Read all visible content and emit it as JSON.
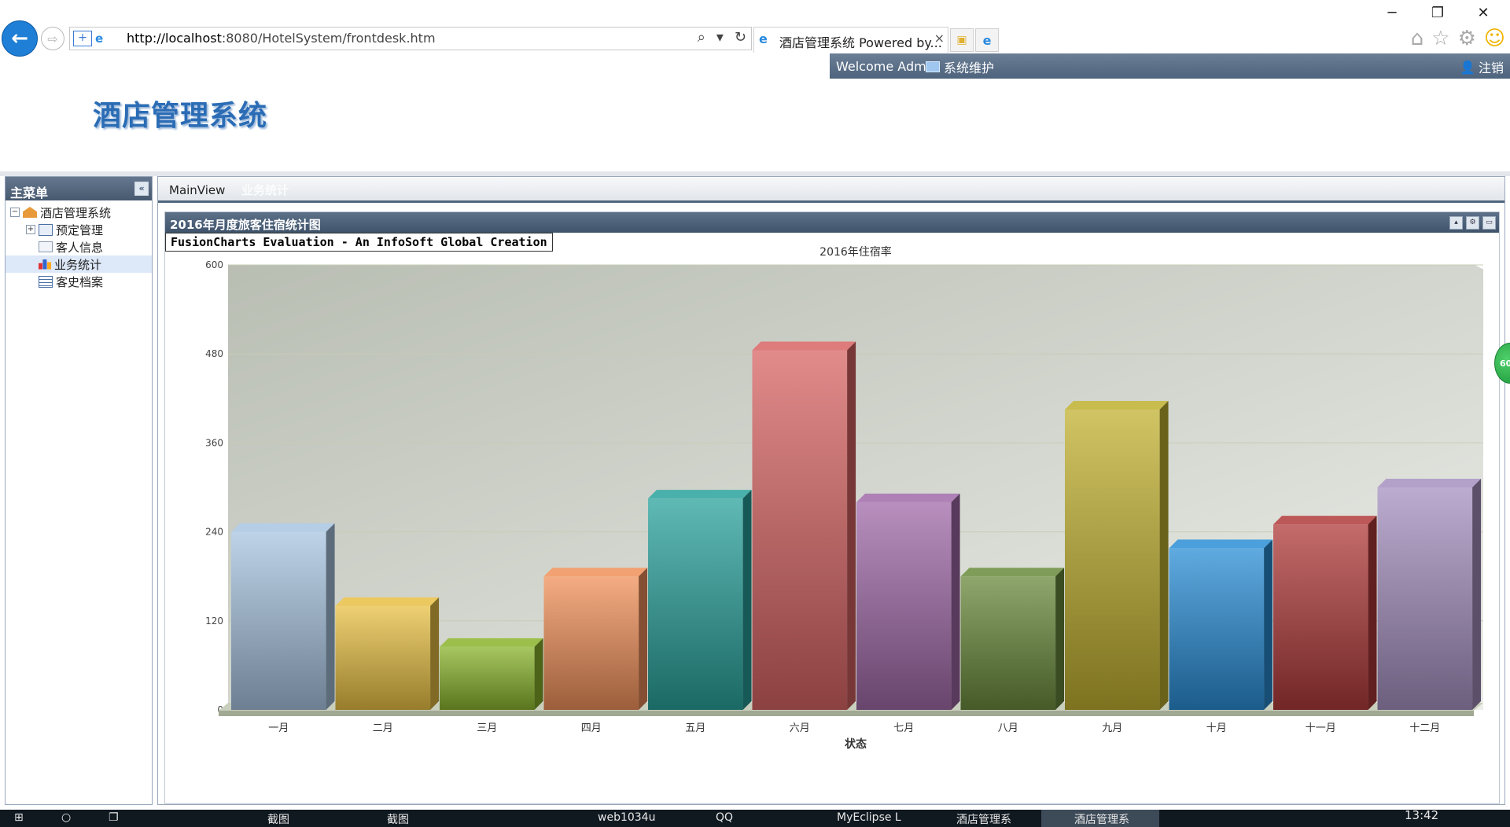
{
  "browser": {
    "url_host": "http://localhost",
    "url_rest": ":8080/HotelSystem/frontdesk.htm",
    "tab_title": "酒店管理系统 Powered by...",
    "tab_close": "×",
    "back_icon": "←",
    "forward_icon": "⇨"
  },
  "header": {
    "welcome": "Welcome Admin",
    "maintenance": "系统维护",
    "logout": "注销",
    "app_title": "酒店管理系统"
  },
  "sidebar": {
    "title": "主菜单",
    "items": [
      {
        "label": "酒店管理系统"
      },
      {
        "label": "预定管理"
      },
      {
        "label": "客人信息"
      },
      {
        "label": "业务统计"
      },
      {
        "label": "客史档案"
      }
    ]
  },
  "tabs": {
    "main_view": "MainView",
    "stats": "业务统计"
  },
  "portlet": {
    "title": "2016年月度旅客住宿统计图"
  },
  "fusion_notice": "FusionCharts Evaluation - An InfoSoft Global Creation",
  "edge_badge": "60",
  "chart_data": {
    "type": "bar",
    "title": "2016年住宿率",
    "xlabel": "状态",
    "ylabel": "",
    "ylim": [
      0,
      600
    ],
    "yticks": [
      0,
      120,
      240,
      360,
      480,
      600
    ],
    "categories": [
      "一月",
      "二月",
      "三月",
      "四月",
      "五月",
      "六月",
      "七月",
      "八月",
      "九月",
      "十月",
      "十一月",
      "十二月"
    ],
    "values": [
      240,
      140,
      85,
      180,
      285,
      485,
      280,
      180,
      405,
      218,
      250,
      300
    ],
    "colors": [
      "#a8c4e0",
      "#e8c044",
      "#8ab42c",
      "#f0905a",
      "#2aa29c",
      "#d86464",
      "#a06aa8",
      "#6a8a3c",
      "#c0b030",
      "#2a8ed6",
      "#b03a3a",
      "#a690c0"
    ]
  },
  "taskbar": {
    "items": [
      "截图",
      "截图",
      "web1034u",
      "QQ",
      "MyEclipse L",
      "酒店管理系",
      "酒店管理系"
    ],
    "clock": "13:42"
  }
}
